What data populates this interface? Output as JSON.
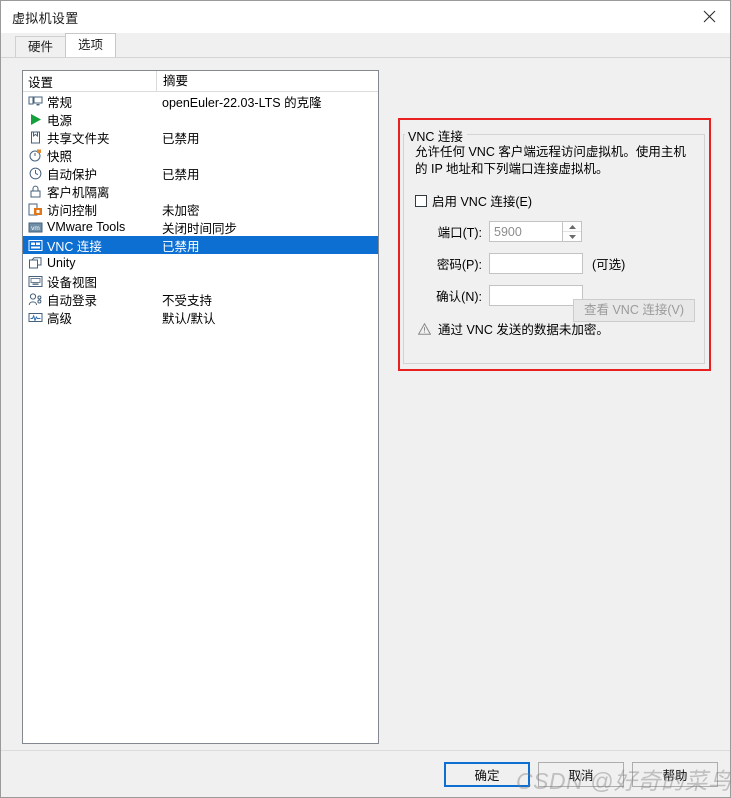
{
  "window": {
    "title": "虚拟机设置",
    "close_label": "✕"
  },
  "tabs": [
    {
      "label": "硬件",
      "active": false
    },
    {
      "label": "选项",
      "active": true
    }
  ],
  "settings_list": {
    "columns": [
      "设置",
      "摘要"
    ],
    "rows": [
      {
        "icon": "monitor-icon",
        "name": "常规",
        "summary": "openEuler-22.03-LTS 的克隆",
        "selected": false
      },
      {
        "icon": "power-play-icon",
        "name": "电源",
        "summary": "",
        "selected": false
      },
      {
        "icon": "shared-folder-icon",
        "name": "共享文件夹",
        "summary": "已禁用",
        "selected": false
      },
      {
        "icon": "snapshot-clock-icon",
        "name": "快照",
        "summary": "",
        "selected": false
      },
      {
        "icon": "autoprotect-clock-icon",
        "name": "自动保护",
        "summary": "已禁用",
        "selected": false
      },
      {
        "icon": "lock-icon",
        "name": "客户机隔离",
        "summary": "",
        "selected": false
      },
      {
        "icon": "access-control-icon",
        "name": "访问控制",
        "summary": "未加密",
        "selected": false
      },
      {
        "icon": "vmware-tools-icon",
        "name": "VMware Tools",
        "summary": "关闭时间同步",
        "selected": false
      },
      {
        "icon": "vnc-icon",
        "name": "VNC 连接",
        "summary": "已禁用",
        "selected": true
      },
      {
        "icon": "unity-icon",
        "name": "Unity",
        "summary": "",
        "selected": false
      },
      {
        "icon": "device-view-icon",
        "name": "设备视图",
        "summary": "",
        "selected": false
      },
      {
        "icon": "auto-login-icon",
        "name": "自动登录",
        "summary": "不受支持",
        "selected": false
      },
      {
        "icon": "advanced-icon",
        "name": "高级",
        "summary": "默认/默认",
        "selected": false
      }
    ]
  },
  "vnc_panel": {
    "legend": "VNC 连接",
    "description": "允许任何 VNC 客户端远程访问虚拟机。使用主机的 IP 地址和下列端口连接虚拟机。",
    "enable_checkbox": {
      "label": "启用 VNC 连接(E)",
      "checked": false
    },
    "port": {
      "label": "端口(T):",
      "value": "5900"
    },
    "password": {
      "label": "密码(P):",
      "value": "",
      "hint": "(可选)"
    },
    "confirm": {
      "label": "确认(N):",
      "value": ""
    },
    "warning": {
      "icon": "warning-triangle-icon",
      "text": "通过 VNC 发送的数据未加密。"
    },
    "view_button": {
      "label": "查看 VNC 连接(V)",
      "disabled": true
    },
    "highlight_color": "#e8201f"
  },
  "footer": {
    "ok": "确定",
    "cancel": "取消",
    "help": "帮助"
  },
  "watermark": {
    "text": "CSDN @好奇的菜鸟"
  },
  "colors": {
    "selection": "#0d6fd1",
    "accent": "#0d6fd1",
    "dialog_bg": "#f0f0f0"
  }
}
